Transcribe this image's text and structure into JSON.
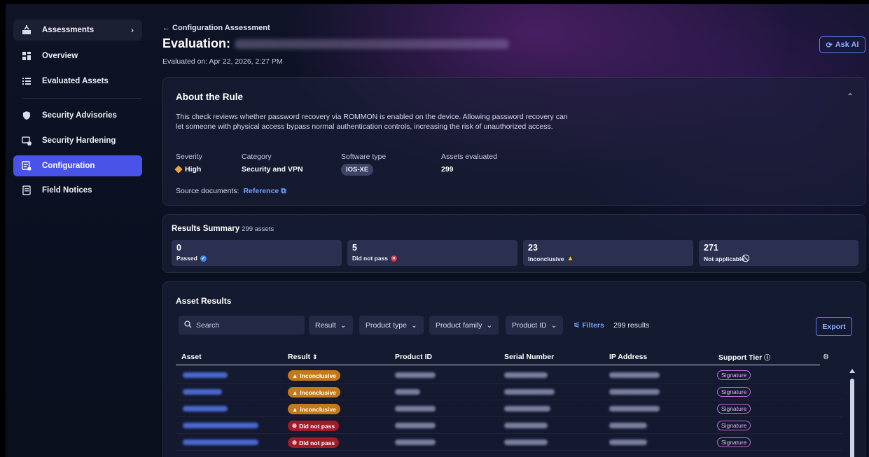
{
  "sidebar": {
    "items": [
      {
        "label": "Assessments",
        "icon": "assessments-icon"
      },
      {
        "label": "Overview",
        "icon": "overview-icon"
      },
      {
        "label": "Evaluated Assets",
        "icon": "list-icon"
      },
      {
        "label": "Security Advisories",
        "icon": "shield-icon"
      },
      {
        "label": "Security Hardening",
        "icon": "hardening-icon"
      },
      {
        "label": "Configuration",
        "icon": "configuration-icon"
      },
      {
        "label": "Field Notices",
        "icon": "field-notice-icon"
      }
    ]
  },
  "header": {
    "back_label": "← Configuration Assessment",
    "title_prefix": "Evaluation:",
    "evaluated_on": "Evaluated on: Apr 22, 2026, 2:27 PM",
    "ask_ai": "Ask AI"
  },
  "about": {
    "title": "About the Rule",
    "description": "This check reviews whether password recovery via ROMMON is enabled on the device. Allowing password recovery can let someone with physical access bypass normal authentication controls, increasing the risk of unauthorized access.",
    "severity_label": "Severity",
    "severity_value": "High",
    "category_label": "Category",
    "category_value": "Security and VPN",
    "software_label": "Software type",
    "software_value": "IOS-XE",
    "assets_label": "Assets evaluated",
    "assets_value": "299",
    "source_label": "Source documents:",
    "source_link": "Reference"
  },
  "summary": {
    "title": "Results Summary",
    "subtitle": "299 assets",
    "stats": [
      {
        "value": "0",
        "label": "Passed",
        "color": "#3b8cf0"
      },
      {
        "value": "5",
        "label": "Did not pass",
        "color": "#d8344a"
      },
      {
        "value": "23",
        "label": "Inconclusive",
        "color": "#f0c419"
      },
      {
        "value": "271",
        "label": "Not applicable",
        "color": "#e6e8f2"
      }
    ]
  },
  "assets": {
    "title": "Asset Results",
    "search_placeholder": "Search",
    "filters": [
      "Result",
      "Product type",
      "Product family",
      "Product ID"
    ],
    "filters_link": "Filters",
    "results_count": "299 results",
    "export_label": "Export",
    "columns": [
      "Asset",
      "Result",
      "Product ID",
      "Serial Number",
      "IP Address",
      "Support Tier"
    ],
    "rows": [
      {
        "result": "Inconclusive",
        "tier": "Signature"
      },
      {
        "result": "Inconclusive",
        "tier": "Signature"
      },
      {
        "result": "Inconclusive",
        "tier": "Signature"
      },
      {
        "result": "Did not pass",
        "tier": "Signature"
      },
      {
        "result": "Did not pass",
        "tier": "Signature"
      }
    ]
  }
}
